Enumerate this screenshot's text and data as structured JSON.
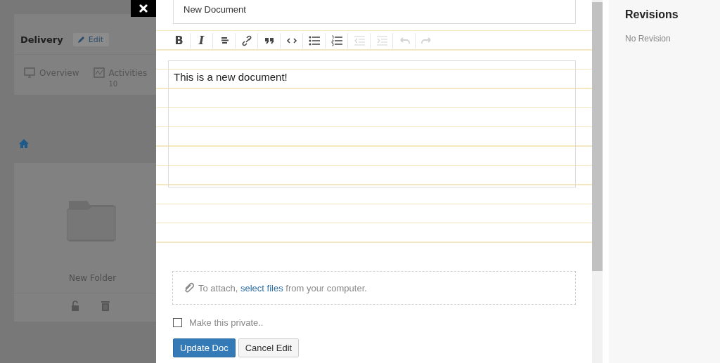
{
  "background_page": {
    "project": {
      "title": "Delivery",
      "edit_button": "Edit"
    },
    "tabs": [
      {
        "kind": "overview",
        "label": "Overview"
      },
      {
        "kind": "activities",
        "label": "Activities",
        "count": "10"
      }
    ],
    "folders": [
      {
        "name": "New Folder"
      }
    ]
  },
  "document_editor": {
    "title_value": "New Document",
    "toolbar": [
      {
        "kind": "bold",
        "glyph": "B",
        "disabled": false
      },
      {
        "kind": "italic",
        "glyph": "I",
        "disabled": false
      },
      {
        "kind": "strike",
        "disabled": false
      },
      {
        "kind": "link",
        "disabled": false
      },
      {
        "kind": "quote",
        "disabled": false
      },
      {
        "kind": "code",
        "disabled": false
      },
      {
        "kind": "bullets",
        "disabled": false
      },
      {
        "kind": "numbers",
        "disabled": false
      },
      {
        "kind": "outdent",
        "disabled": true
      },
      {
        "kind": "indent",
        "disabled": true
      },
      {
        "kind": "undo",
        "disabled": true
      },
      {
        "kind": "redo",
        "disabled": true
      }
    ],
    "body": "This is a new document!",
    "attach": {
      "before": "To attach, ",
      "link": "select files",
      "after": " from your computer."
    },
    "private_checkbox": {
      "label": "Make this private..",
      "checked": false
    },
    "buttons": [
      {
        "kind": "primary",
        "label": "Update Doc"
      },
      {
        "kind": "default",
        "label": "Cancel Edit"
      }
    ]
  },
  "revisions": {
    "title": "Revisions",
    "empty_text": "No Revision"
  }
}
